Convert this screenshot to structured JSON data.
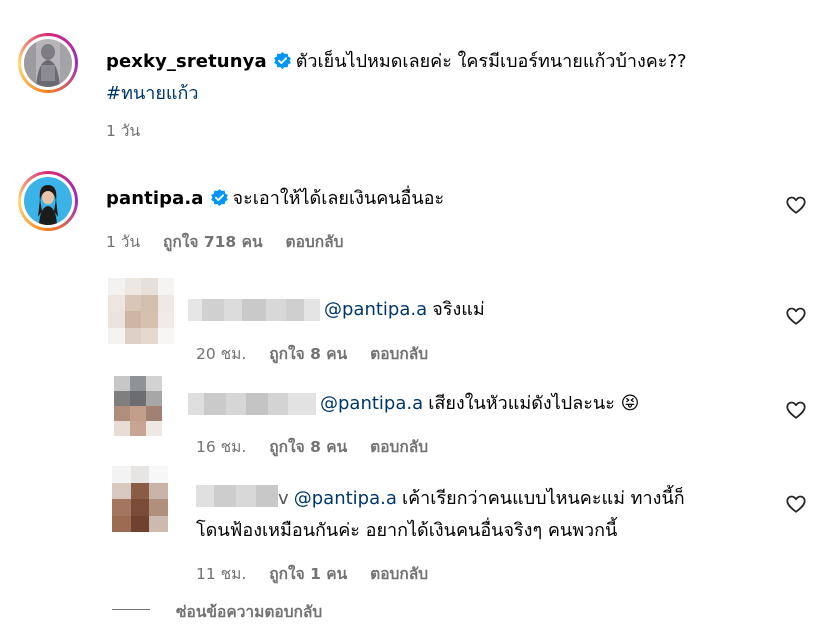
{
  "post": {
    "username": "pexky_sretunya",
    "text": "ตัวเย็นไปหมดเลยค่ะ ใครมีเบอร์ทนายแก้วบ้างคะ??",
    "hashtag": "#ทนายแก้ว",
    "time": "1 วัน"
  },
  "comment": {
    "username": "pantipa.a",
    "text": "จะเอาให้ได้เลยเงินคนอื่นอะ",
    "time": "1 วัน",
    "likes": "ถูกใจ 718 คน",
    "reply_label": "ตอบกลับ"
  },
  "replies": [
    {
      "mention": "@pantipa.a",
      "text": "จริงแม่",
      "time": "20 ชม.",
      "likes": "ถูกใจ 8 คน",
      "reply_label": "ตอบกลับ"
    },
    {
      "mention": "@pantipa.a",
      "text": "เสียงในหัวแม่ดังไปละนะ 😝",
      "time": "16 ชม.",
      "likes": "ถูกใจ 8 คน",
      "reply_label": "ตอบกลับ"
    },
    {
      "name_suffix": "v",
      "mention": "@pantipa.a",
      "text_line1": "เค้าเรียกว่าคนแบบไหนคะแม่ ทางนี้ก็",
      "text_line2": "โดนฟ้องเหมือนกันค่ะ อยากได้เงินคนอื่นจริงๆ คนพวกนี้",
      "time": "11 ชม.",
      "likes": "ถูกใจ 1 คน",
      "reply_label": "ตอบกลับ"
    }
  ],
  "hide_replies_label": "ซ่อนข้อความตอบกลับ",
  "colors": {
    "verified": "#0095f6",
    "link": "#00376b",
    "meta": "#737373"
  },
  "icons": [
    "verified-badge-icon",
    "heart-outline-icon"
  ]
}
